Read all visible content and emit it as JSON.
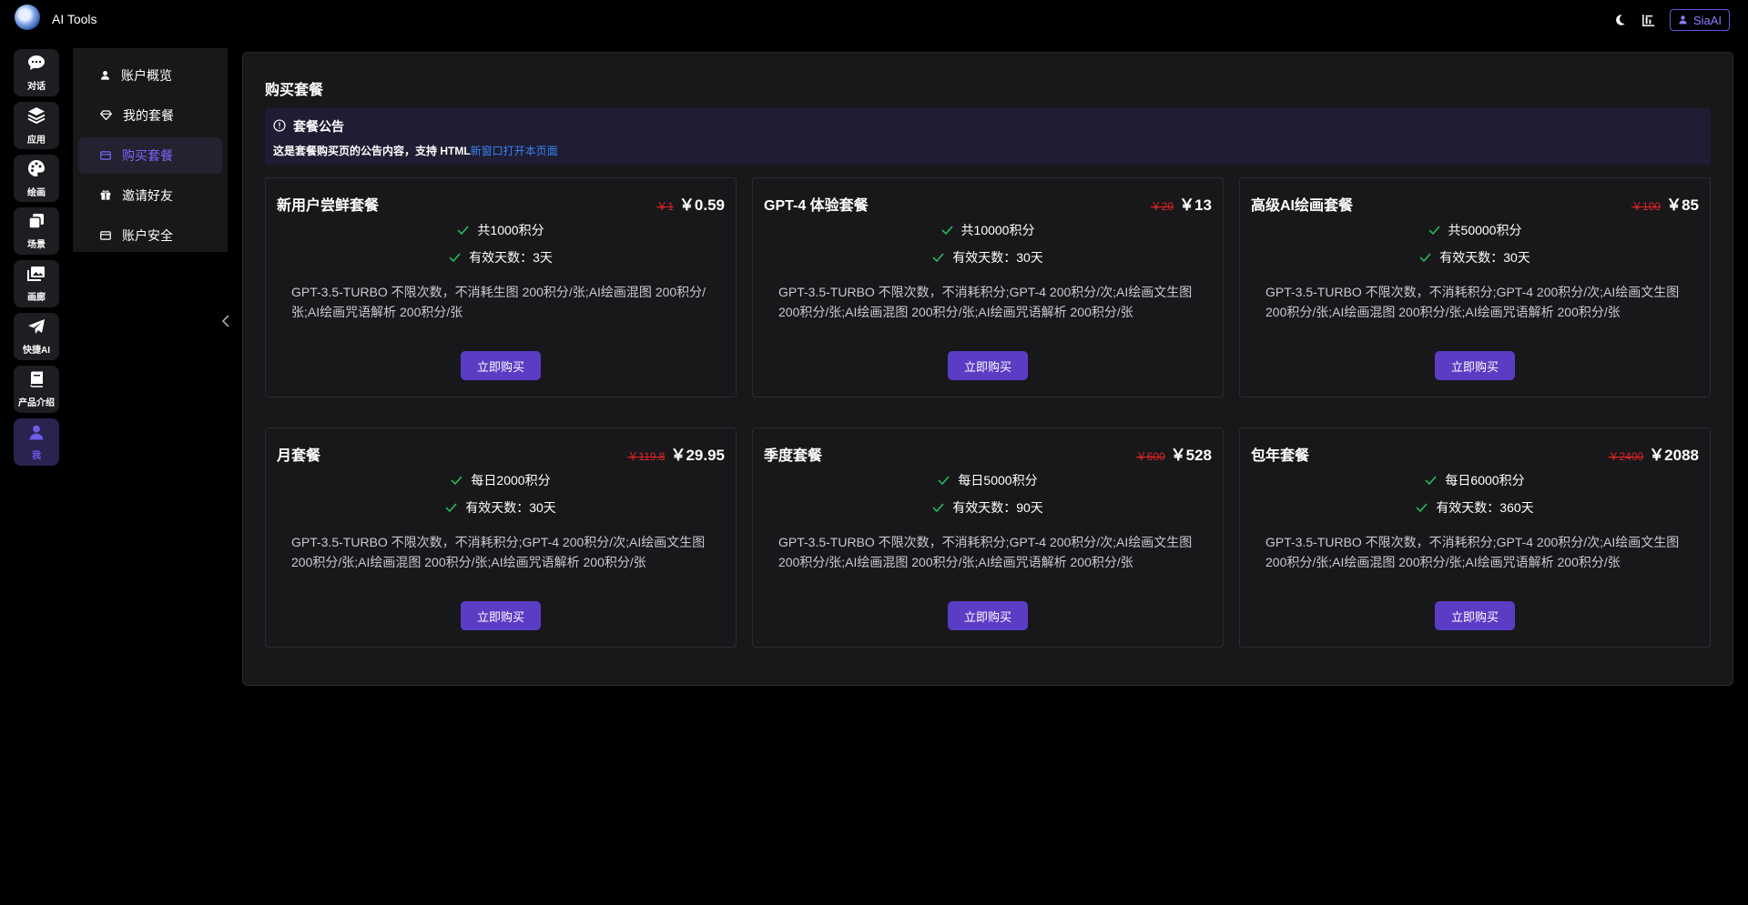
{
  "app": {
    "title": "AI Tools"
  },
  "header": {
    "user_label": "SiaAI"
  },
  "rail": {
    "items": [
      {
        "label": "对话",
        "icon": "chat-icon"
      },
      {
        "label": "应用",
        "icon": "layers-icon"
      },
      {
        "label": "绘画",
        "icon": "palette-icon"
      },
      {
        "label": "场景",
        "icon": "scenes-icon"
      },
      {
        "label": "画廊",
        "icon": "gallery-icon"
      },
      {
        "label": "快捷AI",
        "icon": "send-icon"
      },
      {
        "label": "产品介绍",
        "icon": "book-icon"
      },
      {
        "label": "我",
        "icon": "user-icon"
      }
    ]
  },
  "submenu": {
    "items": [
      {
        "label": "账户概览",
        "icon": "user-icon"
      },
      {
        "label": "我的套餐",
        "icon": "diamond-icon"
      },
      {
        "label": "购买套餐",
        "icon": "card-icon"
      },
      {
        "label": "邀请好友",
        "icon": "gift-icon"
      },
      {
        "label": "账户安全",
        "icon": "card-icon"
      }
    ],
    "active_index": 2
  },
  "page": {
    "title": "购买套餐"
  },
  "notice": {
    "title": "套餐公告",
    "text": "这是套餐购买页的公告内容，支持 HTML",
    "link": "新窗口打开本页面"
  },
  "buy_label": "立即购买",
  "colors": {
    "accent": "#5b3cc4",
    "old_price": "#e02424",
    "check": "#22c55e",
    "link": "#3b82f6"
  },
  "packages": [
    {
      "name": "新用户尝鲜套餐",
      "old_price": "￥1",
      "price": "￥0.59",
      "feature1": "共1000积分",
      "feature2": "有效天数：3天",
      "desc": "GPT-3.5-TURBO 不限次数，不消耗生图 200积分/张;AI绘画混图 200积分/张;AI绘画咒语解析 200积分/张"
    },
    {
      "name": "GPT-4 体验套餐",
      "old_price": "￥20",
      "price": "￥13",
      "feature1": "共10000积分",
      "feature2": "有效天数：30天",
      "desc": "GPT-3.5-TURBO 不限次数，不消耗积分;GPT-4 200积分/次;AI绘画文生图 200积分/张;AI绘画混图 200积分/张;AI绘画咒语解析 200积分/张"
    },
    {
      "name": "高级AI绘画套餐",
      "old_price": "￥100",
      "price": "￥85",
      "feature1": "共50000积分",
      "feature2": "有效天数：30天",
      "desc": "GPT-3.5-TURBO 不限次数，不消耗积分;GPT-4 200积分/次;AI绘画文生图 200积分/张;AI绘画混图 200积分/张;AI绘画咒语解析 200积分/张"
    },
    {
      "name": "月套餐",
      "old_price": "￥119.8",
      "price": "￥29.95",
      "feature1": "每日2000积分",
      "feature2": "有效天数：30天",
      "desc": "GPT-3.5-TURBO 不限次数，不消耗积分;GPT-4 200积分/次;AI绘画文生图 200积分/张;AI绘画混图 200积分/张;AI绘画咒语解析 200积分/张"
    },
    {
      "name": "季度套餐",
      "old_price": "￥600",
      "price": "￥528",
      "feature1": "每日5000积分",
      "feature2": "有效天数：90天",
      "desc": "GPT-3.5-TURBO 不限次数，不消耗积分;GPT-4 200积分/次;AI绘画文生图 200积分/张;AI绘画混图 200积分/张;AI绘画咒语解析 200积分/张"
    },
    {
      "name": "包年套餐",
      "old_price": "￥2400",
      "price": "￥2088",
      "feature1": "每日6000积分",
      "feature2": "有效天数：360天",
      "desc": "GPT-3.5-TURBO 不限次数，不消耗积分;GPT-4 200积分/次;AI绘画文生图 200积分/张;AI绘画混图 200积分/张;AI绘画咒语解析 200积分/张"
    }
  ]
}
